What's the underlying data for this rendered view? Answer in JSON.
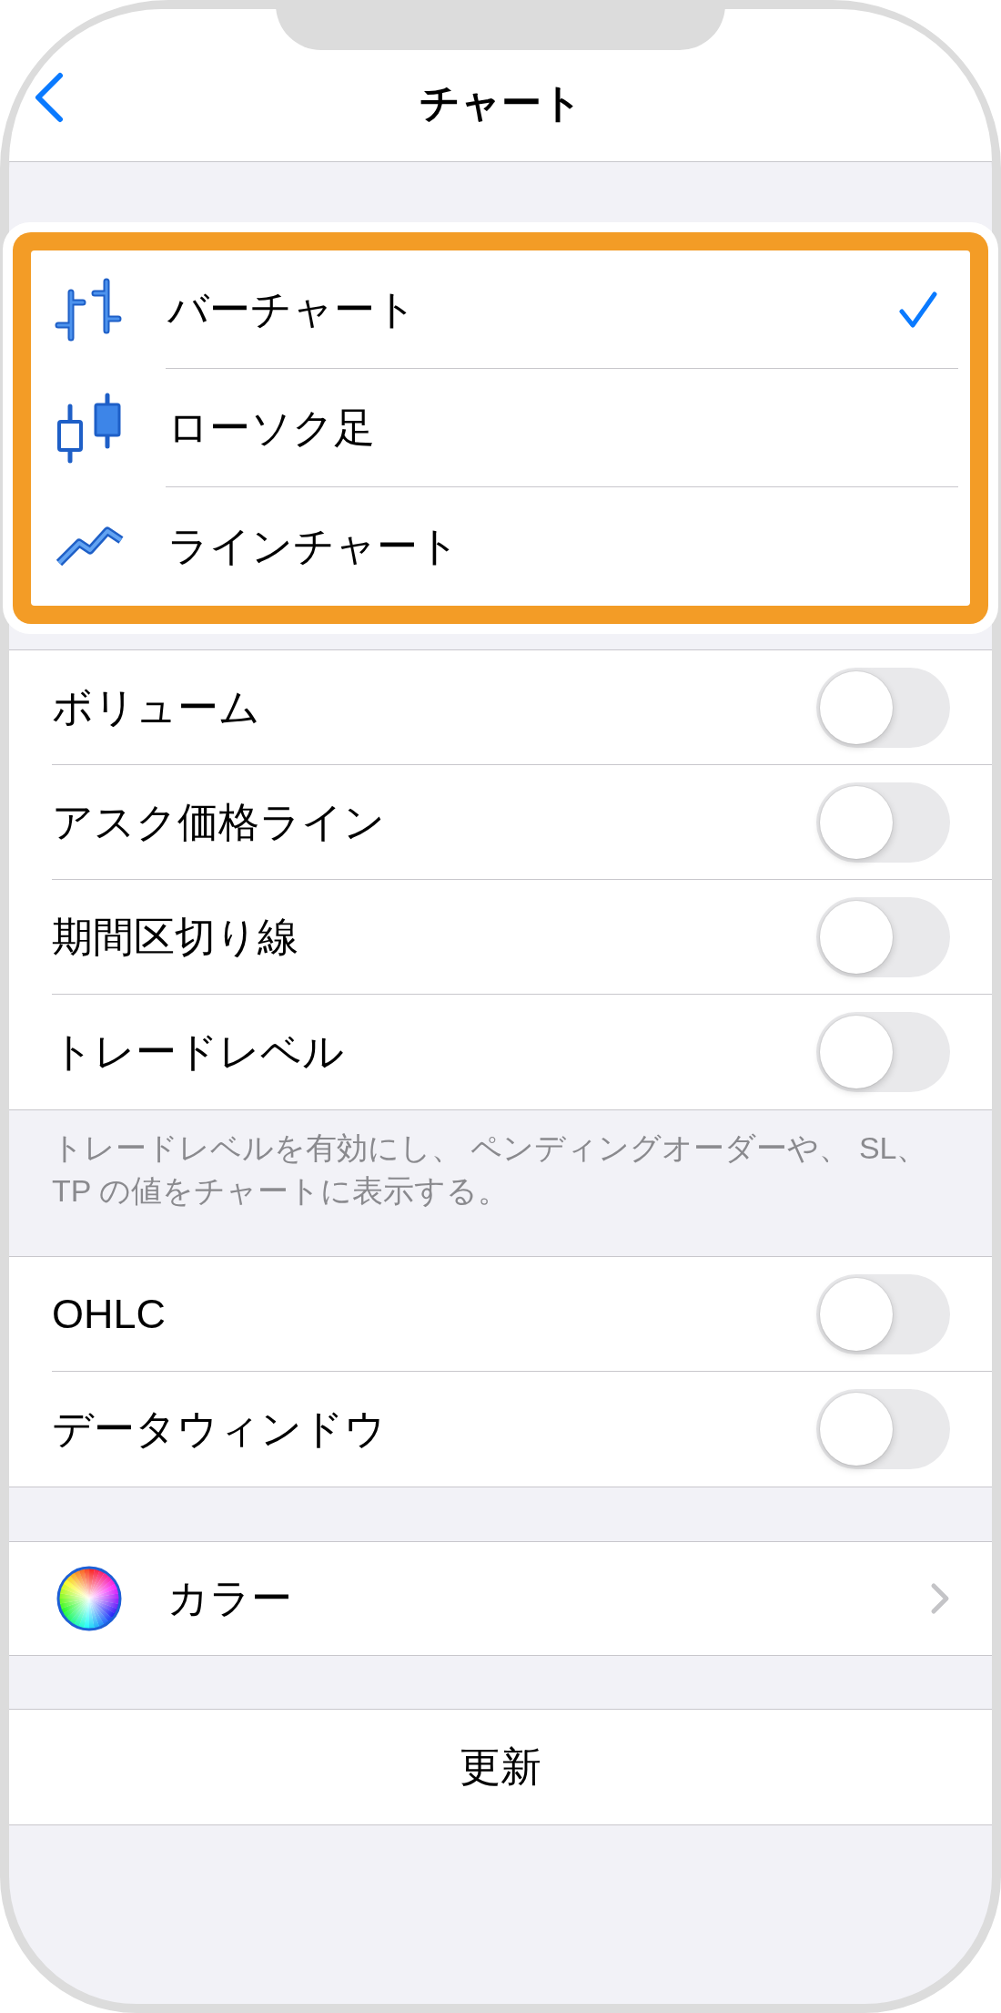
{
  "nav_bar": {
    "title": "チャート"
  },
  "chart_types": {
    "highlighted": true,
    "items": [
      {
        "kind": "bar",
        "label": "バーチャート",
        "selected": true
      },
      {
        "kind": "candlestick",
        "label": "ローソク足",
        "selected": false
      },
      {
        "kind": "line",
        "label": "ラインチャート",
        "selected": false
      }
    ]
  },
  "chart_options": {
    "toggles": [
      {
        "label": "ボリューム",
        "on": false
      },
      {
        "label": "アスク価格ライン",
        "on": false
      },
      {
        "label": "期間区切り線",
        "on": false
      },
      {
        "label": "トレードレベル",
        "on": false
      }
    ],
    "footer": "トレードレベルを有効にし、 ペンディングオーダーや、 SL、TP の値をチャートに表示する。"
  },
  "display_options": {
    "toggles": [
      {
        "label": "OHLC",
        "on": false
      },
      {
        "label": "データウィンドウ",
        "on": false
      }
    ]
  },
  "color_item": {
    "label": "カラー"
  },
  "refresh_button": {
    "label": "更新"
  }
}
